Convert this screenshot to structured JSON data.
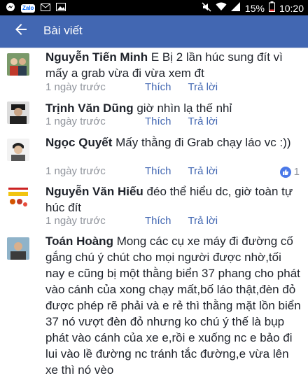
{
  "status_bar": {
    "zalo_label": "Zalo",
    "battery_text": "15%",
    "time": "10:20"
  },
  "header": {
    "title": "Bài viết"
  },
  "comments": [
    {
      "author": "Nguyễn Tiến Minh",
      "text": "E Bị 2 lần húc sung đít vì mấy a grab vừa đi vừa xem đt",
      "time": "1 ngày trước",
      "like_label": "Thích",
      "reply_label": "Trả lời"
    },
    {
      "author": "Trịnh Văn Dũng",
      "text": "giờ nhìn lạ thế nhỉ",
      "time": "1 ngày trước",
      "like_label": "Thích",
      "reply_label": "Trả lời"
    },
    {
      "author": "Ngọc Quyết",
      "text": "Mấy thằng đi Grab chạy láo vc :))",
      "time": "1 ngày trước",
      "like_label": "Thích",
      "reply_label": "Trả lời",
      "reaction_count": "1"
    },
    {
      "author": "Nguyễn Văn Hiếu",
      "text": "đéo thể hiểu dc, giờ toàn tự húc đít",
      "time": "1 ngày trước",
      "like_label": "Thích",
      "reply_label": "Trả lời"
    },
    {
      "author": "Toán Hoàng",
      "text": "Mong các cụ xe máy đi đường cố gắng chú ý chút cho mọi người được nhờ,tối nay e cũng bị một thằng biển 37 phang cho phát vào cánh của xong chạy mất,bố láo thật,đèn đỏ được phép rẽ phải và e rẻ thì thằng mặt lồn biển 37 nó vượt đèn đỏ nhưng ko chú ý thế là bụp phát vào cánh của xe e,rồi e xuống nc e bảo đi lui vào lề đường nc tránh tắc đường,e vừa lên xe thì nó vèo"
    }
  ],
  "colors": {
    "brand_blue": "#4267b2",
    "link_blue": "#4267b2",
    "meta_gray": "#90949c",
    "text": "#1d2129"
  }
}
